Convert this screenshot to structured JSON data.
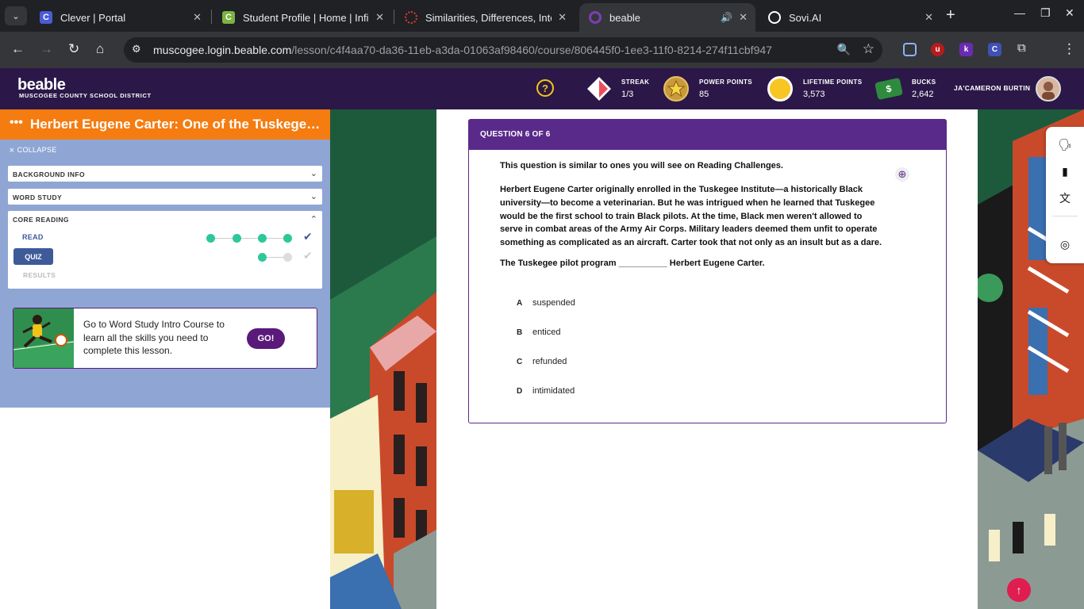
{
  "browser": {
    "tabs": [
      {
        "title": "Clever | Portal",
        "favicon_letter": "C",
        "favicon_color": "#4a5bd7"
      },
      {
        "title": "Student Profile | Home | Infinite",
        "favicon_letter": "C",
        "favicon_color": "#7cb342"
      },
      {
        "title": "Similarities, Differences, Intere",
        "favicon_letter": "",
        "favicon_color": "#e53935"
      },
      {
        "title": "beable",
        "favicon_letter": "",
        "favicon_color": "#5a1a7a"
      },
      {
        "title": "Sovi.AI",
        "favicon_letter": "",
        "favicon_color": "#ffffff"
      }
    ],
    "url_host": "muscogee.login.beable.com",
    "url_path": "/lesson/c4f4aa70-da36-11eb-a3da-01063af98460/course/806445f0-1ee3-11f0-8214-274f11cbf947"
  },
  "header": {
    "logo": "beable",
    "district": "MUSCOGEE COUNTY SCHOOL DISTRICT",
    "stats": [
      {
        "label": "STREAK",
        "value": "1/3"
      },
      {
        "label": "POWER POINTS",
        "value": "85"
      },
      {
        "label": "LIFETIME POINTS",
        "value": "3,573"
      },
      {
        "label": "BUCKS",
        "value": "2,642"
      }
    ],
    "username": "JA'CAMERON BURTIN"
  },
  "sidebar": {
    "lesson_title": "Herbert Eugene Carter: One of the Tuskegee Airmen",
    "collapse_label": "COLLAPSE",
    "sections": [
      {
        "label": "BACKGROUND INFO"
      },
      {
        "label": "WORD STUDY"
      },
      {
        "label": "CORE READING"
      }
    ],
    "steps": {
      "read": "READ",
      "quiz": "QUIZ",
      "results": "RESULTS"
    },
    "promo": {
      "text": "Go to Word Study Intro Course to learn all the skills you need to complete this lesson.",
      "button": "GO!"
    }
  },
  "question": {
    "header": "QUESTION 6 OF 6",
    "intro": "This question is similar to ones you will see on Reading Challenges.",
    "passage": "Herbert Eugene Carter originally enrolled in the Tuskegee Institute—a historically Black university—to become a veterinarian. But he was intrigued when he learned that Tuskegee would be the first school to train Black pilots. At the time, Black men weren't allowed to serve in combat areas of the Army Air Corps. Military leaders deemed them unfit to operate something as complicated as an aircraft. Carter took that not only as an insult but as a dare.",
    "prompt": "The Tuskegee pilot program __________ Herbert Eugene Carter.",
    "options": [
      {
        "letter": "A",
        "text": "suspended"
      },
      {
        "letter": "B",
        "text": "enticed"
      },
      {
        "letter": "C",
        "text": "refunded"
      },
      {
        "letter": "D",
        "text": "intimidated"
      }
    ]
  },
  "colors": {
    "brand_purple": "#5a2a8a",
    "orange": "#f57c10",
    "green_dot": "#2ec79a"
  }
}
